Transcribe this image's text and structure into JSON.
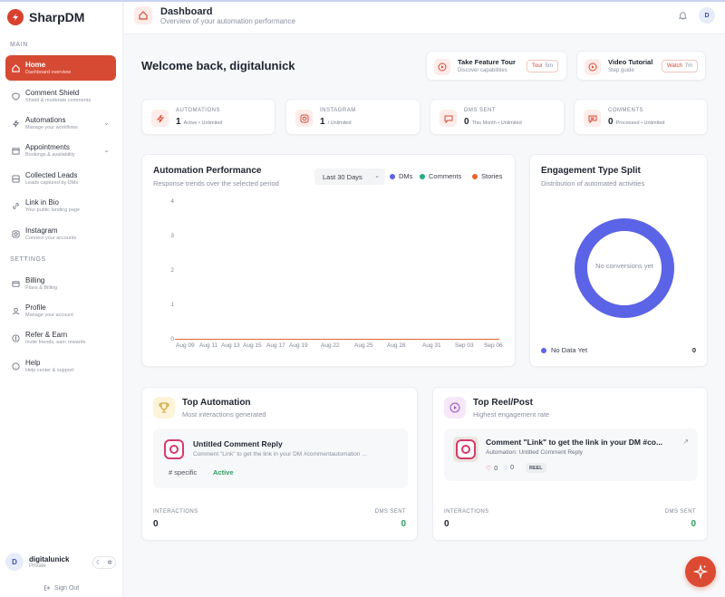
{
  "brand": {
    "name": "SharpDM",
    "accent": "#d64a34"
  },
  "sidebar": {
    "main_label": "MAIN",
    "settings_label": "SETTINGS",
    "items": [
      {
        "label": "Home",
        "sub": "Dashboard overview"
      },
      {
        "label": "Comment Shield",
        "sub": "Shield & moderate comments"
      },
      {
        "label": "Automations",
        "sub": "Manage your workflows"
      },
      {
        "label": "Appointments",
        "sub": "Bookings & availability"
      },
      {
        "label": "Collected Leads",
        "sub": "Leads captured by DMs"
      },
      {
        "label": "Link in Bio",
        "sub": "Your public landing page"
      },
      {
        "label": "Instagram",
        "sub": "Connect your accounts"
      }
    ],
    "settings_items": [
      {
        "label": "Billing",
        "sub": "Plans & Billing"
      },
      {
        "label": "Profile",
        "sub": "Manage your account"
      },
      {
        "label": "Refer & Earn",
        "sub": "Invite friends, earn rewards"
      },
      {
        "label": "Help",
        "sub": "Help center & support"
      }
    ],
    "user": {
      "initial": "D",
      "name": "digitalunick",
      "role": "Private"
    },
    "signout": "Sign Out"
  },
  "header": {
    "title": "Dashboard",
    "subtitle": "Overview of your automation performance",
    "avatar": "D"
  },
  "welcome": "Welcome back, digitalunick",
  "tours": [
    {
      "title": "Take Feature Tour",
      "sub": "Discover capabilities",
      "btn": "Tour",
      "min": "5m"
    },
    {
      "title": "Video Tutorial",
      "sub": "Step guide",
      "btn": "Watch",
      "min": "7m"
    }
  ],
  "stats": [
    {
      "label": "AUTOMATIONS",
      "value": "1",
      "sub": "Active • Unlimited"
    },
    {
      "label": "INSTAGRAM",
      "value": "1",
      "sub": "/ Unlimited"
    },
    {
      "label": "DMS SENT",
      "value": "0",
      "sub": "This Month • Unlimited"
    },
    {
      "label": "COMMENTS",
      "value": "0",
      "sub": "Processed • Unlimited"
    }
  ],
  "performance": {
    "title": "Automation Performance",
    "subtitle": "Response trends over the selected period",
    "range": "Last 30 Days",
    "legend": [
      "DMs",
      "Comments",
      "Stories"
    ],
    "colors": [
      "#5b63e6",
      "#22b07d",
      "#e8652d"
    ],
    "yticks": [
      "4",
      "3",
      "2",
      "1",
      "0"
    ],
    "xticks": [
      "Aug 09",
      "Aug 11",
      "Aug 13",
      "Aug 15",
      "Aug 17",
      "Aug 19",
      "Aug 22",
      "Aug 25",
      "Aug 28",
      "Aug 31",
      "Sep 03",
      "Sep 06"
    ]
  },
  "engagement": {
    "title": "Engagement Type Split",
    "subtitle": "Distribution of automated activities",
    "center": "No conversions yet",
    "legend": "No Data Yet",
    "value": "0"
  },
  "top_automation": {
    "title": "Top Automation",
    "subtitle": "Most interactions generated",
    "name": "Untitled Comment Reply",
    "desc": "Comment \"Link\" to get the link in your DM #commentautomation ...",
    "tag": "# specific",
    "status": "Active",
    "f1_label": "INTERACTIONS",
    "f1": "0",
    "f2_label": "DMS SENT",
    "f2": "0"
  },
  "top_reel": {
    "title": "Top Reel/Post",
    "subtitle": "Highest engagement rate",
    "name": "Comment \"Link\" to get the link in your DM #co...",
    "automation": "Automation: Untitled Comment Reply",
    "likes": "0",
    "comments": "0",
    "type": "REEL",
    "f1_label": "INTERACTIONS",
    "f1": "0",
    "f2_label": "DMS SENT",
    "f2": "0"
  },
  "chart_data": {
    "type": "line",
    "title": "Automation Performance",
    "categories": [
      "Aug 09",
      "Aug 11",
      "Aug 13",
      "Aug 15",
      "Aug 17",
      "Aug 19",
      "Aug 22",
      "Aug 25",
      "Aug 28",
      "Aug 31",
      "Sep 03",
      "Sep 06"
    ],
    "series": [
      {
        "name": "DMs",
        "values": [
          0,
          0,
          0,
          0,
          0,
          0,
          0,
          0,
          0,
          0,
          0,
          0
        ]
      },
      {
        "name": "Comments",
        "values": [
          0,
          0,
          0,
          0,
          0,
          0,
          0,
          0,
          0,
          0,
          0,
          0
        ]
      },
      {
        "name": "Stories",
        "values": [
          0,
          0,
          0,
          0,
          0,
          0,
          0,
          0,
          0,
          0,
          0,
          0
        ]
      }
    ],
    "ylim": [
      0,
      4
    ],
    "legend": "top-right"
  }
}
